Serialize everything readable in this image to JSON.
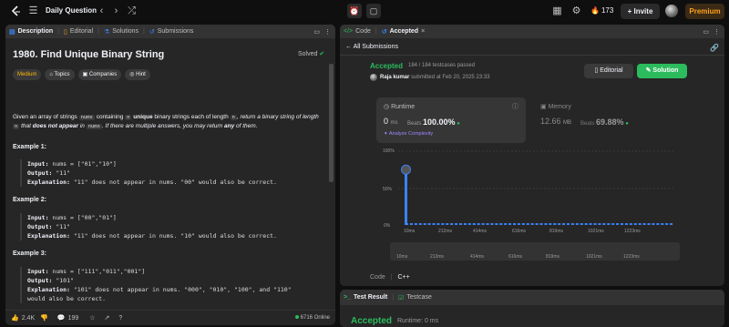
{
  "topbar": {
    "title": "Daily Question",
    "streak": "173",
    "invite": "Invite",
    "premium": "Premium"
  },
  "left": {
    "tabs": [
      {
        "label": "Description",
        "icon": "description-icon"
      },
      {
        "label": "Editorial",
        "icon": "book-icon"
      },
      {
        "label": "Solutions",
        "icon": "flask-icon"
      },
      {
        "label": "Submissions",
        "icon": "history-icon"
      }
    ],
    "question_title": "1980. Find Unique Binary String",
    "solved": "Solved",
    "chips": [
      "Medium",
      "Topics",
      "Companies",
      "Hint"
    ],
    "desc": {
      "p1": "Given an array of strings",
      "nums": "nums",
      "p2": "containing",
      "n": "n",
      "p3": "unique",
      "p4": "binary strings each of length",
      "p5": ", return a binary string of length",
      "p6": "that",
      "p7": "does not appear",
      "p8": "in",
      "p9": ". If there are multiple answers, you may return",
      "p10": "any",
      "p11": "of them."
    },
    "examples": [
      {
        "title": "Example 1:",
        "input": "nums = [\"01\",\"10\"]",
        "output": "\"11\"",
        "explanation": "\"11\" does not appear in nums. \"00\" would also be correct."
      },
      {
        "title": "Example 2:",
        "input": "nums = [\"00\",\"01\"]",
        "output": "\"11\"",
        "explanation": "\"11\" does not appear in nums. \"10\" would also be correct."
      },
      {
        "title": "Example 3:",
        "input": "nums = [\"111\",\"011\",\"001\"]",
        "output": "\"101\"",
        "explanation": "\"101\" does not appear in nums. \"000\", \"010\", \"100\", and \"110\"",
        "explanation2": "would also be correct."
      }
    ],
    "footer": {
      "likes": "2.4K",
      "comments": "199",
      "online": "6716 Online"
    },
    "labels": {
      "input": "Input:",
      "output": "Output:",
      "explanation": "Explanation:"
    }
  },
  "right": {
    "tabs": [
      {
        "label": "Code"
      },
      {
        "label": "Accepted"
      }
    ],
    "all_submissions": "All Submissions",
    "status": "Accepted",
    "tests": "184 / 184 testcases passed",
    "user": "Raja kumar",
    "submitted": "submitted at Feb 20, 2025 23:33",
    "editorial_btn": "Editorial",
    "solution_btn": "Solution",
    "runtime": {
      "label": "Runtime",
      "value": "0",
      "unit": "ms",
      "beats_label": "Beats",
      "beats": "100.00%",
      "analyze": "Analyze Complexity"
    },
    "memory": {
      "label": "Memory",
      "value": "12.66",
      "unit": "MB",
      "beats_label": "Beats",
      "beats": "69.88%"
    },
    "code_label": "Code",
    "lang": "C++"
  },
  "bottom": {
    "tab1": "Test Result",
    "tab2": "Testcase",
    "status": "Accepted",
    "runtime": "Runtime: 0 ms"
  },
  "chart_data": {
    "type": "bar",
    "y_ticks": [
      "100%",
      "50%",
      "0%"
    ],
    "categories": [
      "10ms",
      "212ms",
      "414ms",
      "616ms",
      "819ms",
      "1021ms",
      "1223ms"
    ],
    "mini_ticks": [
      "10ms",
      "213ms",
      "414ms",
      "616ms",
      "819ms",
      "1021ms",
      "1223ms"
    ],
    "highlight_value": 0.75,
    "accent": "#3b82f6"
  }
}
